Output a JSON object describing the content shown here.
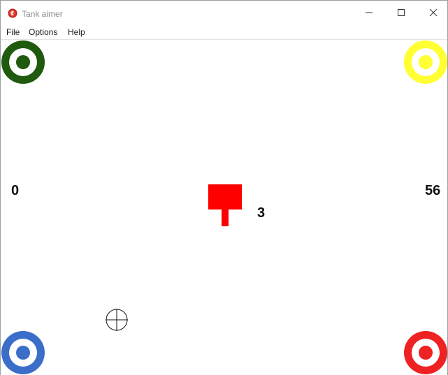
{
  "window": {
    "title": "Tank aimer",
    "app_icon": "tank-app-icon",
    "controls": {
      "minimize": "minimize-icon",
      "maximize": "maximize-icon",
      "close": "close-icon"
    }
  },
  "menu": [
    {
      "label": "File"
    },
    {
      "label": "Options"
    },
    {
      "label": "Help"
    }
  ],
  "game": {
    "targets": [
      {
        "corner": "top-left",
        "color": "#1f5a0f"
      },
      {
        "corner": "top-right",
        "color": "#ffff33"
      },
      {
        "corner": "bottom-left",
        "color": "#3a6ec8"
      },
      {
        "corner": "bottom-right",
        "color": "#ee2222"
      }
    ],
    "score_left": "0",
    "score_right": "56",
    "tank": {
      "color": "#ff0000",
      "count": "3"
    },
    "crosshair_icon": "crosshair-icon"
  }
}
